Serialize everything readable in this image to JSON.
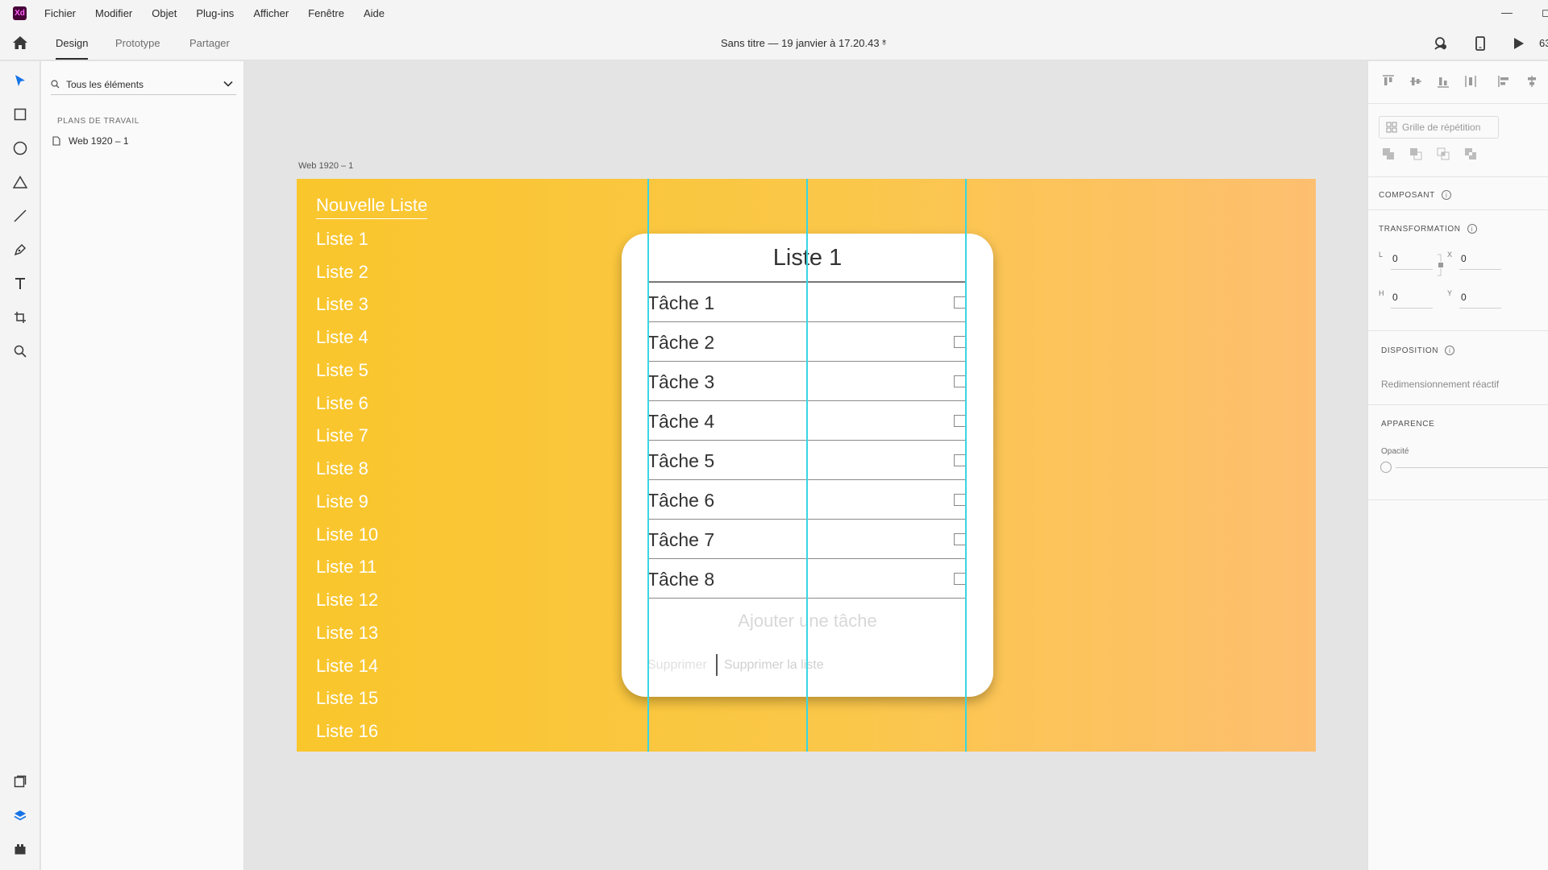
{
  "menubar": {
    "logo": "Xd",
    "items": [
      "Fichier",
      "Modifier",
      "Objet",
      "Plug-ins",
      "Afficher",
      "Fenêtre",
      "Aide"
    ]
  },
  "toolbar": {
    "tabs": [
      "Design",
      "Prototype",
      "Partager"
    ],
    "document_title": "Sans titre — 19 janvier à 17.20.43 *",
    "zoom_partial": "63"
  },
  "layers": {
    "search_label": "Tous les éléments",
    "section": "PLANS DE TRAVAIL",
    "artboard_item": "Web 1920 – 1"
  },
  "canvas": {
    "artboard_label": "Web 1920 – 1",
    "lists": [
      "Nouvelle Liste",
      "Liste 1",
      "Liste 2",
      "Liste 3",
      "Liste 4",
      "Liste 5",
      "Liste 6",
      "Liste 7",
      "Liste 8",
      "Liste 9",
      "Liste 10",
      "Liste 11",
      "Liste 12",
      "Liste 13",
      "Liste 14",
      "Liste 15",
      "Liste 16"
    ],
    "card": {
      "title": "Liste 1",
      "tasks": [
        "Tâche 1",
        "Tâche 2",
        "Tâche 3",
        "Tâche 4",
        "Tâche 5",
        "Tâche 6",
        "Tâche 7",
        "Tâche 8"
      ],
      "add_task": "Ajouter une tâche",
      "delete": "Supprimer",
      "delete_list": "Supprimer la liste"
    }
  },
  "properties": {
    "repeat_grid": "Grille de répétition",
    "component": "COMPOSANT",
    "transform": "TRANSFORMATION",
    "fields": {
      "w_key": "L",
      "w_val": "0",
      "x_key": "X",
      "x_val": "0",
      "h_key": "H",
      "h_val": "0",
      "y_key": "Y",
      "y_val": "0"
    },
    "layout": "DISPOSITION",
    "responsive": "Redimensionnement réactif",
    "appearance": "APPARENCE",
    "opacity": "Opacité"
  },
  "colors": {
    "gradient_start": "#f9c62c",
    "gradient_end": "#fdbf70",
    "guide": "#38d6e4",
    "accent": "#1473e6"
  }
}
